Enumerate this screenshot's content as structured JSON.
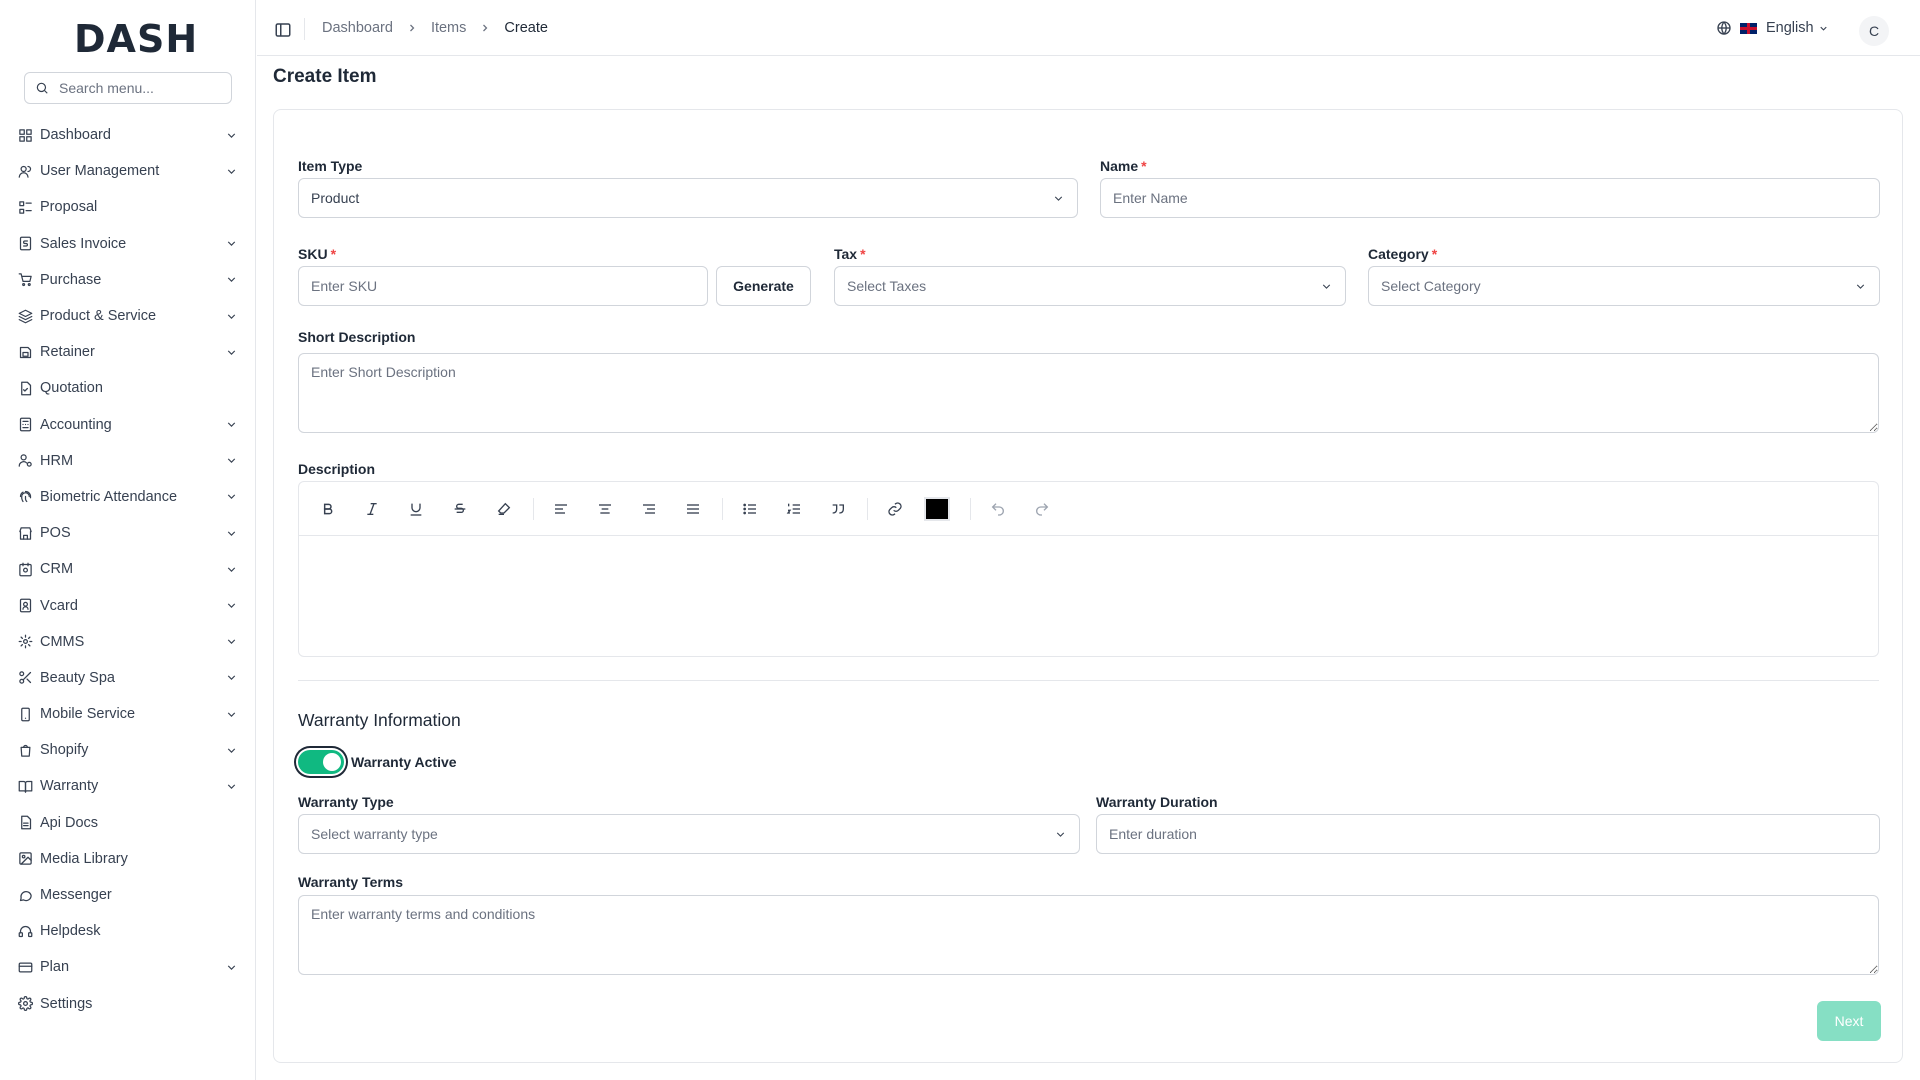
{
  "app": {
    "logo_text": "DASH"
  },
  "sidebar": {
    "search_placeholder": "Search menu...",
    "items": [
      {
        "label": "Dashboard",
        "icon": "grid-icon",
        "has_children": true
      },
      {
        "label": "User Management",
        "icon": "users-icon",
        "has_children": true
      },
      {
        "label": "Proposal",
        "icon": "proposal-icon",
        "has_children": false
      },
      {
        "label": "Sales Invoice",
        "icon": "invoice-icon",
        "has_children": true
      },
      {
        "label": "Purchase",
        "icon": "cart-icon",
        "has_children": true
      },
      {
        "label": "Product & Service",
        "icon": "layers-icon",
        "has_children": true
      },
      {
        "label": "Retainer",
        "icon": "retainer-icon",
        "has_children": true
      },
      {
        "label": "Quotation",
        "icon": "quotation-icon",
        "has_children": false
      },
      {
        "label": "Accounting",
        "icon": "calculator-icon",
        "has_children": true
      },
      {
        "label": "HRM",
        "icon": "hrm-icon",
        "has_children": true
      },
      {
        "label": "Biometric Attendance",
        "icon": "fingerprint-icon",
        "has_children": true
      },
      {
        "label": "POS",
        "icon": "store-icon",
        "has_children": true
      },
      {
        "label": "CRM",
        "icon": "crm-icon",
        "has_children": true
      },
      {
        "label": "Vcard",
        "icon": "vcard-icon",
        "has_children": true
      },
      {
        "label": "CMMS",
        "icon": "cmms-icon",
        "has_children": true
      },
      {
        "label": "Beauty Spa",
        "icon": "scissors-icon",
        "has_children": true
      },
      {
        "label": "Mobile Service",
        "icon": "mobile-icon",
        "has_children": true
      },
      {
        "label": "Shopify",
        "icon": "shopify-icon",
        "has_children": true
      },
      {
        "label": "Warranty",
        "icon": "book-icon",
        "has_children": true
      },
      {
        "label": "Api Docs",
        "icon": "doc-icon",
        "has_children": false
      },
      {
        "label": "Media Library",
        "icon": "image-icon",
        "has_children": false
      },
      {
        "label": "Messenger",
        "icon": "chat-icon",
        "has_children": false
      },
      {
        "label": "Helpdesk",
        "icon": "headset-icon",
        "has_children": false
      },
      {
        "label": "Plan",
        "icon": "plan-icon",
        "has_children": true
      },
      {
        "label": "Settings",
        "icon": "gear-icon",
        "has_children": false
      }
    ]
  },
  "header": {
    "breadcrumb": [
      "Dashboard",
      "Items",
      "Create"
    ],
    "language": "English",
    "avatar_initial": "C"
  },
  "page": {
    "title": "Create Item"
  },
  "form": {
    "item_type": {
      "label": "Item Type",
      "value": "Product"
    },
    "name": {
      "label": "Name",
      "required_mark": "*",
      "placeholder": "Enter Name"
    },
    "sku": {
      "label": "SKU",
      "required_mark": "*",
      "placeholder": "Enter SKU",
      "generate_label": "Generate"
    },
    "tax": {
      "label": "Tax",
      "required_mark": "*",
      "placeholder": "Select Taxes"
    },
    "category": {
      "label": "Category",
      "required_mark": "*",
      "placeholder": "Select Category"
    },
    "short_description": {
      "label": "Short Description",
      "placeholder": "Enter Short Description"
    },
    "description": {
      "label": "Description",
      "text_color": "#000000"
    },
    "warranty": {
      "section_title": "Warranty Information",
      "active_label": "Warranty Active",
      "active": true,
      "type": {
        "label": "Warranty Type",
        "placeholder": "Select warranty type"
      },
      "duration": {
        "label": "Warranty Duration",
        "placeholder": "Enter duration"
      },
      "terms": {
        "label": "Warranty Terms",
        "placeholder": "Enter warranty terms and conditions"
      }
    },
    "next_label": "Next"
  },
  "colors": {
    "accent": "#10b981",
    "next_button": "#86dfc4",
    "required": "#ef4444",
    "border": "#d1d5db"
  }
}
